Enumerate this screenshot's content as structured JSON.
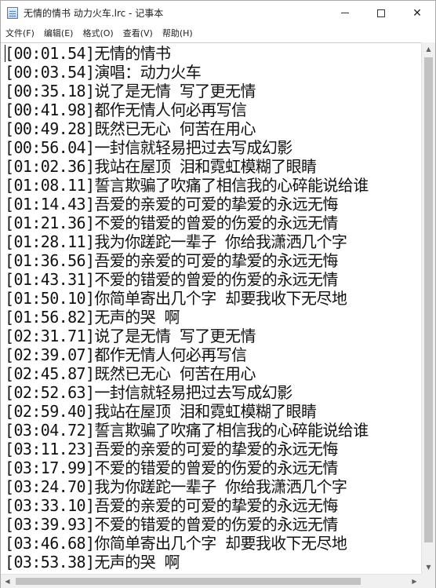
{
  "window": {
    "title": "无情的情书  动力火车.lrc - 记事本"
  },
  "menu": {
    "file": "文件(F)",
    "edit": "编辑(E)",
    "format": "格式(O)",
    "view": "查看(V)",
    "help": "帮助(H)"
  },
  "icons": {
    "app": "notepad-icon",
    "minimize": "minimize-icon",
    "maximize": "maximize-icon",
    "close": "close-icon"
  },
  "editor": {
    "lines": [
      "[00:01.54]无情的情书",
      "[00:03.54]演唱：动力火车",
      "[00:35.18]说了是无情 写了更无情",
      "[00:41.98]都作无情人何必再写信",
      "[00:49.28]既然已无心 何苦在用心",
      "[00:56.04]一封信就轻易把过去写成幻影",
      "[01:02.36]我站在屋顶 泪和霓虹模糊了眼睛",
      "[01:08.11]誓言欺骗了吹痛了相信我的心碎能说给谁",
      "[01:14.43]吾爱的亲爱的可爱的挚爱的永远无悔",
      "[01:21.36]不爱的错爱的曾爱的伤爱的永远无情",
      "[01:28.11]我为你蹉跎一辈子 你给我潇洒几个字",
      "[01:36.56]吾爱的亲爱的可爱的挚爱的永远无悔",
      "[01:43.31]不爱的错爱的曾爱的伤爱的永远无情",
      "[01:50.10]你简单寄出几个字 却要我收下无尽地",
      "[01:56.82]无声的哭 啊",
      "[02:31.71]说了是无情 写了更无情",
      "[02:39.07]都作无情人何必再写信",
      "[02:45.87]既然已无心 何苦在用心",
      "[02:52.63]一封信就轻易把过去写成幻影",
      "[02:59.40]我站在屋顶 泪和霓虹模糊了眼睛",
      "[03:04.72]誓言欺骗了吹痛了相信我的心碎能说给谁",
      "[03:11.23]吾爱的亲爱的可爱的挚爱的永远无悔",
      "[03:17.99]不爱的错爱的曾爱的伤爱的永远无情",
      "[03:24.70]我为你蹉跎一辈子 你给我潇洒几个字",
      "[03:33.10]吾爱的亲爱的可爱的挚爱的永远无悔",
      "[03:39.93]不爱的错爱的曾爱的伤爱的永远无情",
      "[03:46.68]你简单寄出几个字 却要我收下无尽地",
      "[03:53.38]无声的哭 啊"
    ]
  }
}
